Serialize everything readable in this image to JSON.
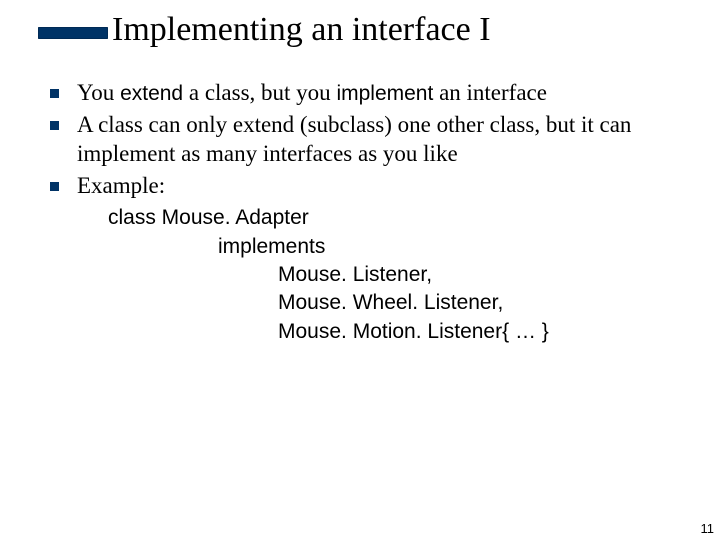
{
  "title": "Implementing an interface I",
  "bullets": {
    "b1": {
      "pre": "You ",
      "kw1": "extend",
      "mid": " a class, but you ",
      "kw2": "implement",
      "post": " an interface"
    },
    "b2": "A class can only extend (subclass) one other class, but it can implement as many interfaces as you like",
    "b3": "Example:"
  },
  "code": {
    "l1": "class Mouse. Adapter",
    "l2": "implements",
    "l3a": "Mouse. Listener,",
    "l3b": "Mouse. Wheel. Listener,",
    "l3c": "Mouse. Motion. Listener{ … }"
  },
  "page_number": "11"
}
